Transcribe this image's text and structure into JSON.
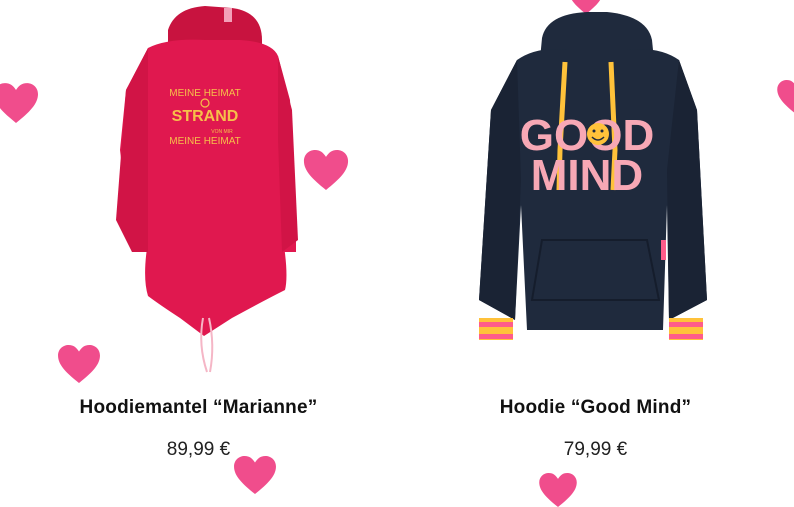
{
  "products": [
    {
      "name": "Hoodiemantel “Marianne”",
      "price": "89,99 €",
      "print_lines": [
        "MEINE HEIMAT",
        "STRAND",
        "MEINE HEIMAT"
      ],
      "print_small": "VON MIR"
    },
    {
      "name": "Hoodie “Good Mind”",
      "price": "79,99 €",
      "print_lines": [
        "GOOD",
        "MIND"
      ]
    }
  ],
  "colors": {
    "heart": "#f04d8c",
    "coat": "#e0184f",
    "hoodie": "#1f2a3d",
    "print_pink": "#f7a8b5",
    "accent_yellow": "#ffc23a",
    "cuff_pink": "#ff5c8a"
  }
}
